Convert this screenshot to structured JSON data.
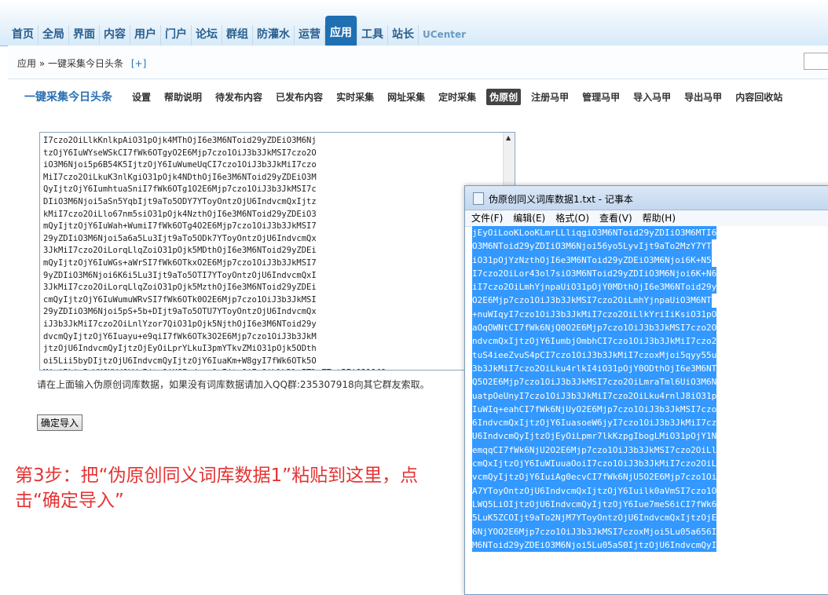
{
  "topnav": {
    "items": [
      "首页",
      "全局",
      "界面",
      "内容",
      "用户",
      "门户",
      "论坛",
      "群组",
      "防灌水",
      "运营",
      "应用",
      "工具",
      "站长",
      "UCenter"
    ],
    "active_index": 10
  },
  "breadcrumb": {
    "root": "应用",
    "separator": "»",
    "current": "一键采集今日头条",
    "add": "[+]"
  },
  "plugin": {
    "title": "一键采集今日头条",
    "menu": [
      "设置",
      "帮助说明",
      "待发布内容",
      "已发布内容",
      "实时采集",
      "网址采集",
      "定时采集",
      "伪原创",
      "注册马甲",
      "管理马甲",
      "导入马甲",
      "导出马甲",
      "内容回收站"
    ],
    "active_index": 7
  },
  "import": {
    "lines": [
      "I7czo2OiLlkKnlkpAiO31pOjk4MThOjI6e3M6NToid29yZDEiO3M6Nj",
      "tzOjY6IuWYseWSkCI7fWk6OTgyO2E6Mjp7czo1OiJ3b3JkMSI7czo2O",
      "iO3M6Njoi5p6B54K5IjtzOjY6IuWumeUqCI7czo1OiJ3b3JkMiI7czo",
      "MiI7czo2OiLkuK3nlKgiO31pOjk4NDthOjI6e3M6NToid29yZDEiO3M",
      "QyIjtzOjY6IumhtuaSniI7fWk6OTg1O2E6Mjp7czo1OiJ3b3JkMSI7c",
      "DIiO3M6Njoi5aSn5YqbIjt9aTo5ODY7YToyOntzOjU6IndvcmQxIjtz",
      "kMiI7czo2OiLlo67nm5siO31pOjk4NzthOjI6e3M6NToid29yZDEiO3",
      "mQyIjtzOjY6IuWah+WumiI7fWk6OTg4O2E6Mjp7czo1OiJ3b3JkMSI7",
      "29yZDIiO3M6Njoi5a6a5Lu3Ijt9aTo5ODk7YToyOntzOjU6IndvcmQx",
      "3JkMiI7czo2OiLorqLlqZoiO31pOjk5MDthOjI6e3M6NToid29yZDEi",
      "mQyIjtzOjY6IuWGs+aWrSI7fWk6OTkxO2E6Mjp7czo1OiJ3b3JkMSI7",
      "9yZDIiO3M6Njoi6K6i5Lu3Ijt9aTo5OTI7YToyOntzOjU6IndvcmQxI",
      "3JkMiI7czo2OiLorqLlqZoiO31pOjk5MzthOjI6e3M6NToid29yZDEi",
      "cmQyIjtzOjY6IuWumuWRvSI7fWk6OTk0O2E6Mjp7czo1OiJ3b3JkMSI",
      "29yZDIiO3M6Njoi5pS+5b+DIjt9aTo5OTU7YToyOntzOjU6IndvcmQx",
      "iJ3b3JkMiI7czo2OiLnlYzor7QiO31pOjk5NjthOjI6e3M6NToid29y",
      "dvcmQyIjtzOjY6Iuayu+e9qiI7fWk6OTk3O2E6Mjp7czo1OiJ3b3JkM",
      "jtzOjU6IndvcmQyIjtzOjEyOiLprYLkuI3pmYTkvZMiO31pOjk5ODth",
      "oi5Lii5byDIjtzOjU6IndvcmQyIjtzOjY6IuaKm+W8gyI7fWk6OTk5O",
      "Mjoi5Lic5aWU6KW/6LWwIjtzOjU6IndvcmQyIjtzOjEyOiLlLDlpITlpZTot5EiO319fQ=="
    ],
    "help": "请在上面输入伪原创词库数据，如果没有词库数据请加入QQ群:235307918向其它群友索取。",
    "confirm": "确定导入"
  },
  "step_note": "第3步：把“伪原创同义词库数据1”粘贴到这里，点击“确定导入”",
  "notepad": {
    "title": "伪原创同义词库数据1.txt - 记事本",
    "menu": [
      "文件(F)",
      "编辑(E)",
      "格式(O)",
      "查看(V)",
      "帮助(H)"
    ],
    "lines": [
      "jEyOiLooKLooKLmrLLliqgiO3M6NToid29yZDIiO3M6MTI6",
      "O3M6NToid29yZDIiO3M6Njoi56yo5LyvIjt9aTo2MzY7YT",
      "iO31pOjYzNzthOjI6e3M6NToid29yZDEiO3M6Njoi6K+N5",
      "I7czo2OiLor43ol7siO3M6NToid29yZDIiO3M6Njoi6K+N6",
      "iI7czo2OiLmhYjnpaUiO31pOjY0MDthOjI6e3M6NToid29y",
      "O2E6Mjp7czo1OiJ3b3JkMSI7czo2OiLmhYjnpaUiO3M6NT",
      "+nuWIqyI7czo1OiJ3b3JkMiI7czo2OiLlkYriIiKsiO31pO",
      "aOqOWNtCI7fWk6NjQ0O2E6Mjp7czo1OiJ3b3JkMSI7czo2O",
      "ndvcmQxIjtzOjY6IumbjOmbhCI7czo1OiJ3b3JkMiI7czo2",
      "tuS4ieeZvuS4pCI7czo1OiJ3b3JkMiI7czoxMjoi5qyy55u",
      "3b3JkMiI7czo2OiLku4rlkI4iO31pOjY0ODthOjI6e3M6NT",
      "Q5O2E6Mjp7czo1OiJ3b3JkMSI7czo2OiLmraTml6UiO3M6N",
      "uatpOeUnyI7czo1OiJ3b3JkMiI7czo2OiLku4rnlJ8iO31p",
      "IuWIq+eahCI7fWk6NjUyO2E6Mjp7czo1OiJ3b3JkMSI7czo",
      "6IndvcmQxIjtzOjY6IuasoeW6jyI7czo1OiJ3b3JkMiI7cz",
      "U6IndvcmQyIjtzOjEyOiLpmr7lkKzpgIbogLMiO31pOjY1N",
      "emqqCI7fWk6NjU2O2E6Mjp7czo1OiJ3b3JkMSI7czo2OiLl",
      "cmQxIjtzOjY6IuWIuuaOoiI7czo1OiJ3b3JkMiI7czo2OiL",
      "vcmQyIjtzOjY6IuiAg0ecvCI7fWk6NjU5O2E6Mjp7czo1Oi",
      "A7YToyOntzOjU6IndvcmQxIjtzOjY6Iuilk0aVmSI7czo1O",
      "LWQ5LiOIjtzOjU6IndvcmQyIjtzOjY6Iue7meS6iCI7fWk6",
      "5LuK5ZCOIjt9aTo2NjM7YToyOntzOjU6IndvcmQxIjtzOjE",
      "6NjYOO2E6Mjp7czo1OiJ3b3JkMSI7czoxMjoi5Lu05a656I",
      "M6NToid29yZDEiO3M6Njoi5Lu05aS0IjtzOjU6IndvcmQyI"
    ]
  }
}
